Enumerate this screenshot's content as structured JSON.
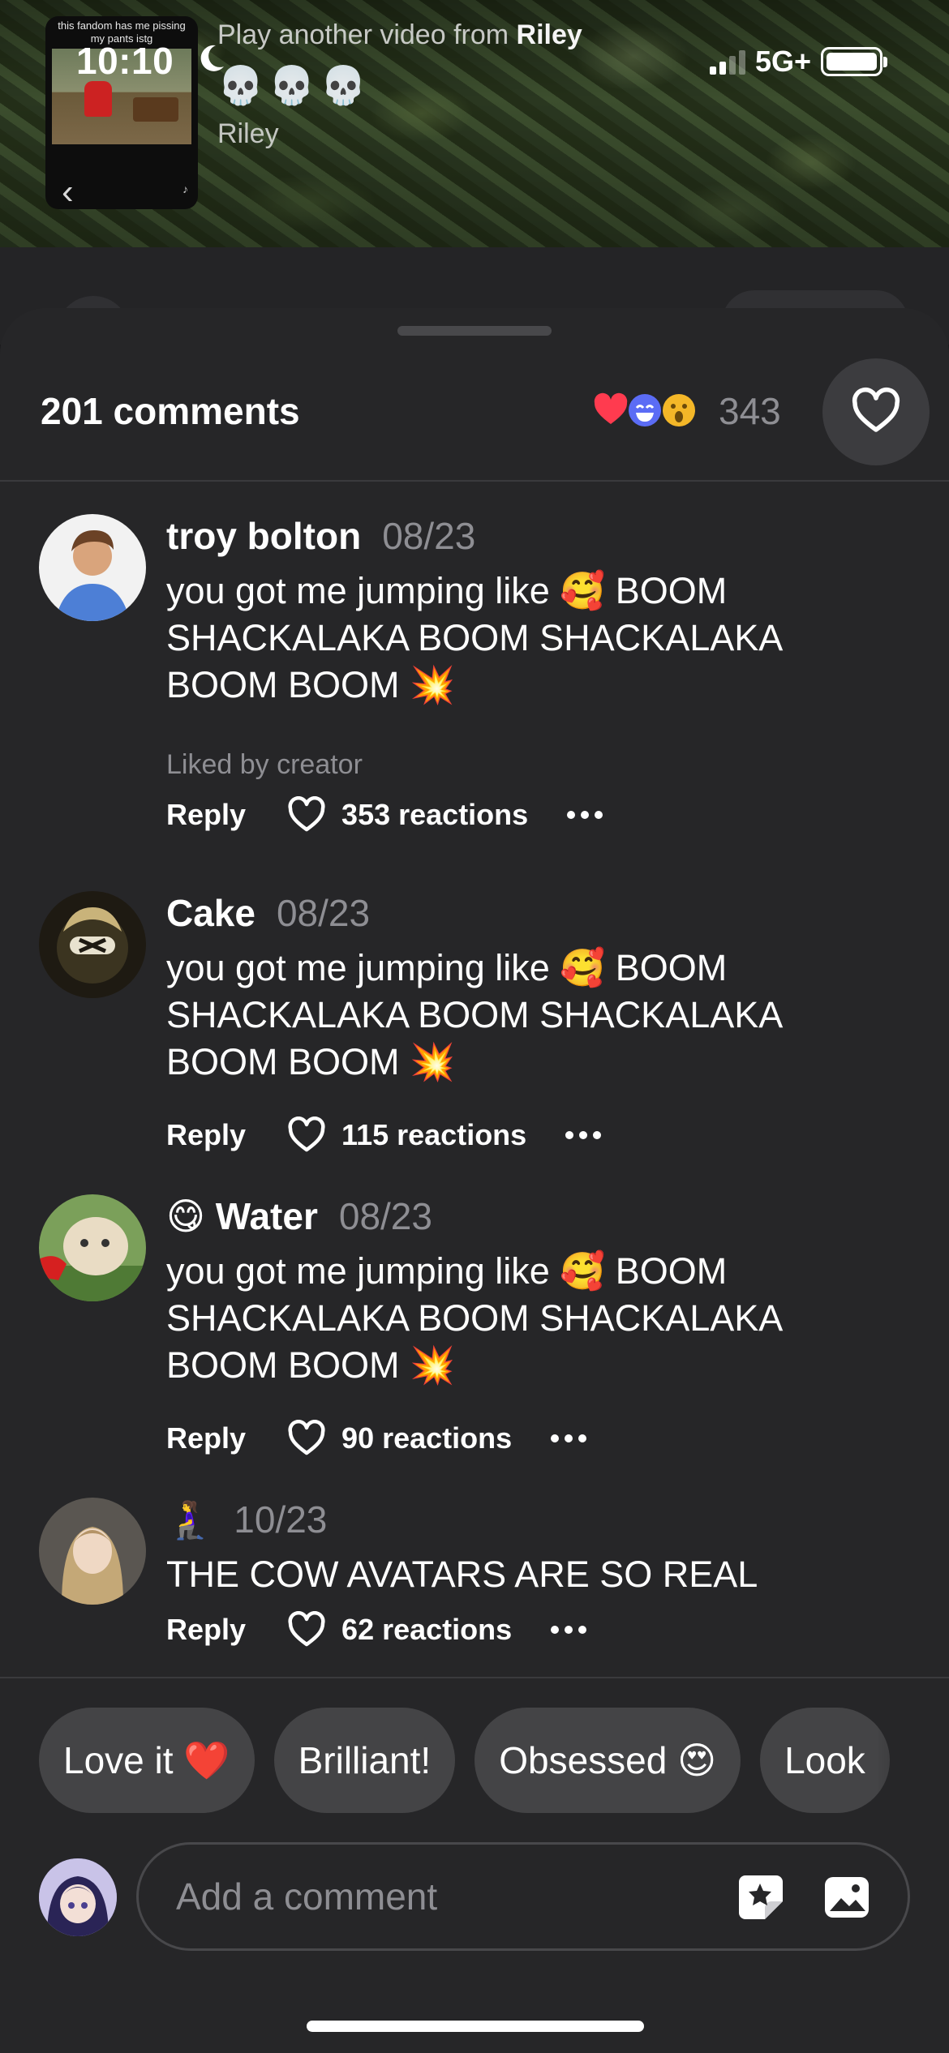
{
  "status_bar": {
    "time": "10:10",
    "network": "5G+"
  },
  "mini_player": {
    "thumb_caption": "this fandom has me pissing my pants istg",
    "play_another_prefix": "Play another video from ",
    "play_another_author": "Riley",
    "emoji_row": "💀💀💀",
    "author": "Riley"
  },
  "sheet": {
    "comments_count": "201 comments",
    "reactions_total": "343",
    "reaction_emojis": [
      "❤️",
      "😆",
      "😮"
    ]
  },
  "comments": [
    {
      "name": "troy bolton",
      "name_prefix_emoji": "",
      "date": "08/23",
      "text": "you got me jumping like 🥰 BOOM SHACKALAKA BOOM SHACKALAKA BOOM BOOM 💥",
      "liked_by": "Liked by creator",
      "reply": "Reply",
      "reactions": "353 reactions"
    },
    {
      "name": "Cake",
      "name_prefix_emoji": "",
      "date": "08/23",
      "text": "you got me jumping like 🥰 BOOM SHACKALAKA BOOM SHACKALAKA BOOM BOOM 💥",
      "liked_by": "",
      "reply": "Reply",
      "reactions": "115 reactions"
    },
    {
      "name": "Water",
      "name_prefix_emoji": "😋",
      "date": "08/23",
      "text": "you got me jumping like 🥰 BOOM SHACKALAKA BOOM SHACKALAKA BOOM BOOM 💥",
      "liked_by": "",
      "reply": "Reply",
      "reactions": "90 reactions"
    },
    {
      "name": "",
      "name_prefix_emoji": "🧎‍♀️",
      "date": "10/23",
      "text": "THE COW AVATARS ARE SO REAL",
      "liked_by": "",
      "reply": "Reply",
      "reactions": "62 reactions"
    }
  ],
  "quick_replies": [
    "Love it ❤️",
    "Brilliant!",
    "Obsessed 😍",
    "Look"
  ],
  "composer": {
    "placeholder": "Add a comment"
  },
  "colors": {
    "sheet_bg": "#262628",
    "muted_text": "#8e8e93",
    "chip_bg": "#444446"
  }
}
